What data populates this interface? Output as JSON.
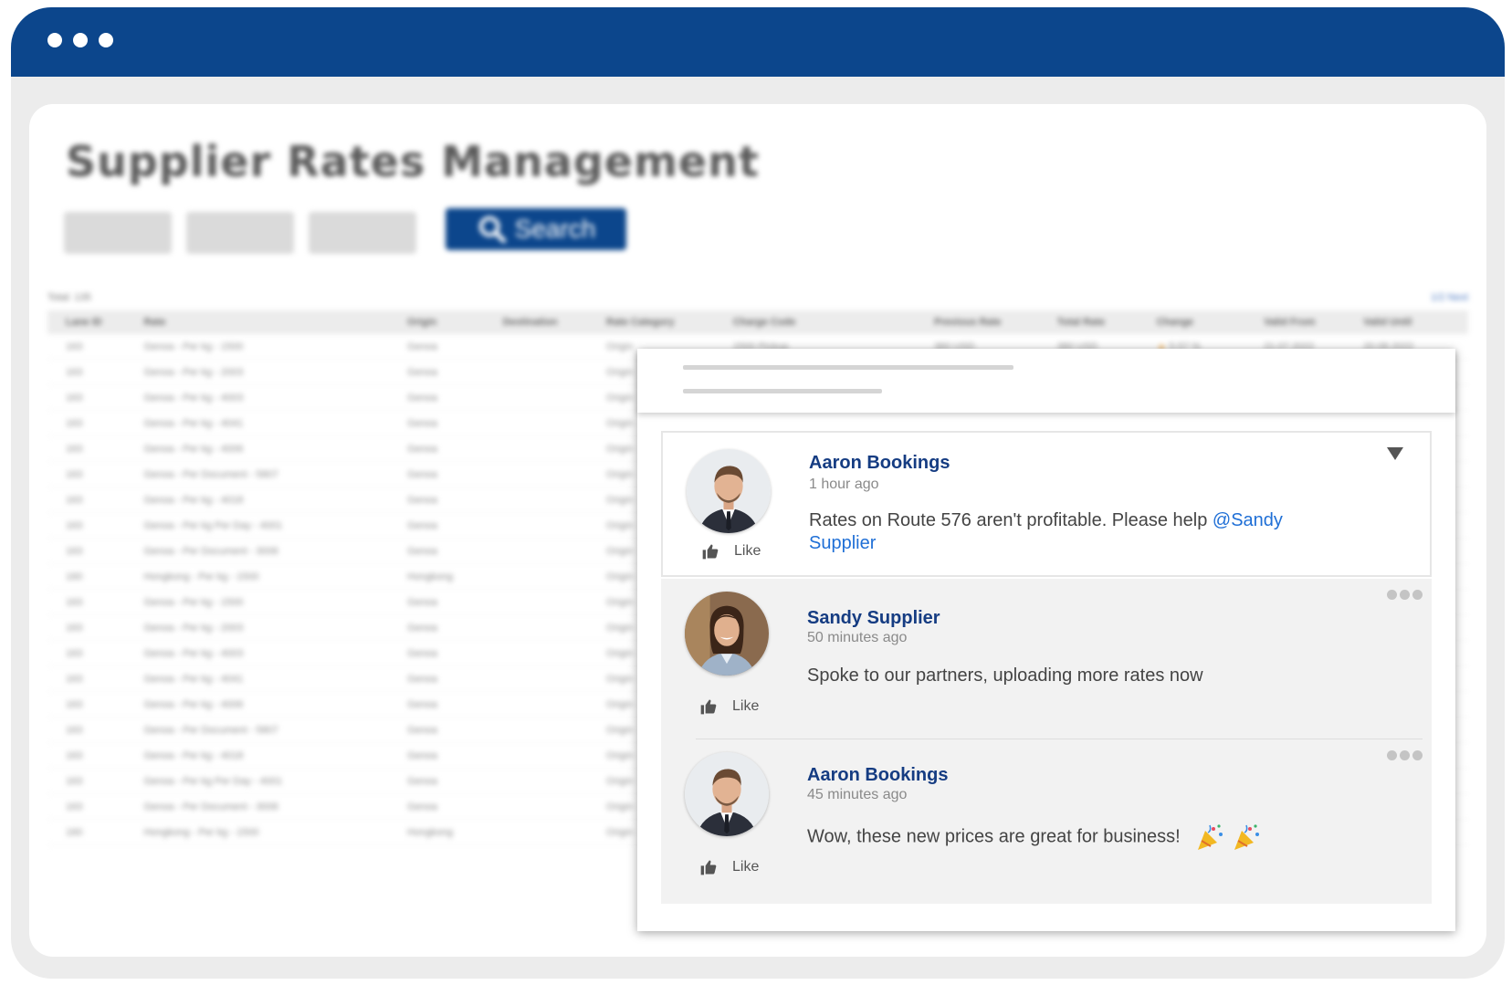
{
  "page": {
    "title": "Supplier Rates Management",
    "search_label": "Search",
    "total_label": "Total: 135",
    "next_label": "1/2 Next"
  },
  "table": {
    "columns": [
      "Lane ID",
      "Rate",
      "Origin",
      "Destination",
      "Rate Category",
      "Charge Code",
      "Previous Rate",
      "Total Rate",
      "Change",
      "Valid From",
      "Valid Until"
    ],
    "first_row": [
      "163",
      "Genoa - Per kg - 1500",
      "Genoa",
      "",
      "Origin",
      "1500 Pickup",
      "360 USD",
      "380 USD",
      "5.57 %",
      "21.07.2022",
      "20.08.2022"
    ],
    "rows": [
      [
        "163",
        "Genoa - Per kg - 2003",
        "Genoa",
        "Origin"
      ],
      [
        "163",
        "Genoa - Per kg - 4003",
        "Genoa",
        "Origin"
      ],
      [
        "163",
        "Genoa - Per kg - 4041",
        "Genoa",
        "Origin"
      ],
      [
        "163",
        "Genoa - Per kg - 4006",
        "Genoa",
        "Origin"
      ],
      [
        "163",
        "Genoa - Per Document - 5807",
        "Genoa",
        "Origin"
      ],
      [
        "163",
        "Genoa - Per kg - 4018",
        "Genoa",
        "Origin"
      ],
      [
        "163",
        "Genoa - Per kg Per Day - 4001",
        "Genoa",
        "Origin"
      ],
      [
        "163",
        "Genoa - Per Document - 3006",
        "Genoa",
        "Origin"
      ],
      [
        "160",
        "Hongkong - Per kg - 1500",
        "Hongkong",
        "Origin"
      ],
      [
        "163",
        "Genoa - Per kg - 1500",
        "Genoa",
        "Origin"
      ],
      [
        "163",
        "Genoa - Per kg - 2003",
        "Genoa",
        "Origin"
      ],
      [
        "163",
        "Genoa - Per kg - 4003",
        "Genoa",
        "Origin"
      ],
      [
        "163",
        "Genoa - Per kg - 4041",
        "Genoa",
        "Origin"
      ],
      [
        "163",
        "Genoa - Per kg - 4006",
        "Genoa",
        "Origin"
      ],
      [
        "163",
        "Genoa - Per Document - 5807",
        "Genoa",
        "Origin"
      ],
      [
        "163",
        "Genoa - Per kg - 4018",
        "Genoa",
        "Origin"
      ],
      [
        "163",
        "Genoa - Per kg Per Day - 4001",
        "Genoa",
        "Origin"
      ],
      [
        "163",
        "Genoa - Per Document - 3006",
        "Genoa",
        "Origin"
      ],
      [
        "160",
        "Hongkong - Per kg - 1500",
        "Hongkong",
        "Origin"
      ]
    ]
  },
  "comments": [
    {
      "author": "Aaron Bookings",
      "time": "1 hour ago",
      "text": "Rates on Route 576 aren't profitable. Please help ",
      "mention": "@Sandy Supplier",
      "like_label": "Like"
    },
    {
      "author": "Sandy Supplier",
      "time": "50 minutes ago",
      "text": "Spoke to our partners, uploading more rates now",
      "like_label": "Like"
    },
    {
      "author": "Aaron Bookings",
      "time": "45 minutes ago",
      "text": "Wow, these new prices are great for business!",
      "like_label": "Like"
    }
  ],
  "colors": {
    "brand": "#0c468c",
    "author": "#153c82",
    "mention": "#1f6fd6"
  },
  "icons": [
    "search-icon",
    "thumbs-up-icon",
    "caret-down-icon",
    "more-dots-icon",
    "party-popper-icon"
  ]
}
